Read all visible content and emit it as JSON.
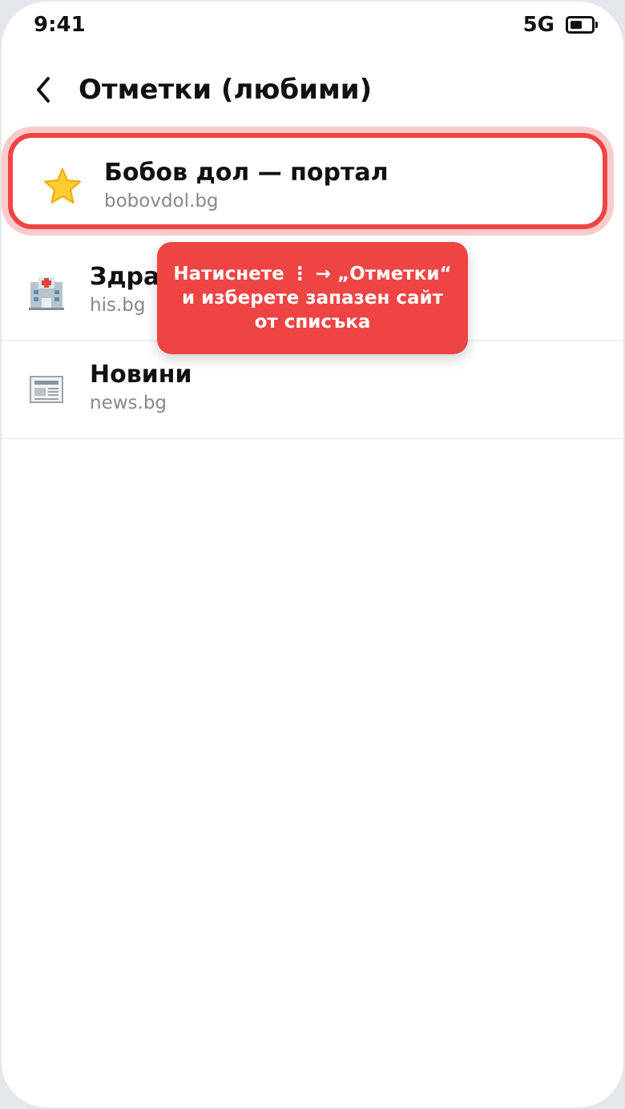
{
  "status_bar": {
    "time": "9:41",
    "network": "5G",
    "battery_level": 0.6
  },
  "header": {
    "title": "Отметки (любими)",
    "back_icon": "chevron-left-icon"
  },
  "bookmarks": [
    {
      "icon": "star-icon",
      "title": "Бобов дол — портал",
      "url": "bobovdol.bg"
    },
    {
      "icon": "hospital-icon",
      "title": "Здравеопазване",
      "url": "his.bg"
    },
    {
      "icon": "newspaper-icon",
      "title": "Новини",
      "url": "news.bg"
    }
  ],
  "tooltip": {
    "text": "Натиснете ⋮ → „Отметки“ и изберете запазен сайт от списъка"
  },
  "colors": {
    "accent": "#ef4444",
    "muted": "#888888"
  }
}
